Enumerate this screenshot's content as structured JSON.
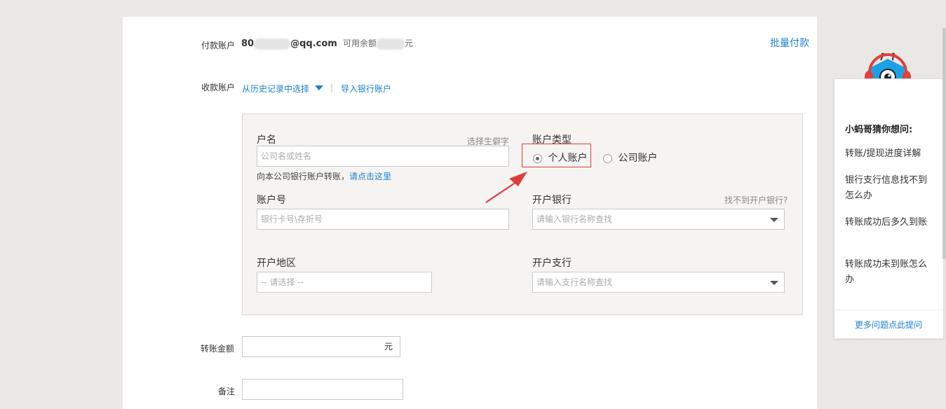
{
  "payer": {
    "label": "付款账户",
    "account_prefix": "80",
    "account_suffix": "@qq.com",
    "balance_label": "可用余额",
    "balance_unit": "元",
    "batch_link": "批量付款"
  },
  "payee": {
    "label": "收款账户",
    "history_link": "从历史记录中选择",
    "separator": "|",
    "import_link": "导入银行账户"
  },
  "form": {
    "name_label": "户名",
    "rare_char_link": "选择生僻字",
    "name_placeholder": "公司名或姓名",
    "company_hint": "向本公司银行账户转账，",
    "company_hint_link": "请点击这里",
    "account_type_label": "账户类型",
    "account_types": [
      {
        "label": "个人账户",
        "selected": true
      },
      {
        "label": "公司账户",
        "selected": false
      }
    ],
    "account_no_label": "账户号",
    "account_no_placeholder": "银行卡号\\存折号",
    "bank_label": "开户银行",
    "bank_missing_link": "找不到开户银行?",
    "bank_placeholder": "请输入银行名称查找",
    "region_label": "开户地区",
    "region_placeholder": "-- 请选择 --",
    "branch_label": "开户支行",
    "branch_placeholder": "请输入支行名称查找"
  },
  "amount": {
    "label": "转账金额",
    "unit": "元"
  },
  "note": {
    "label": "备注"
  },
  "side": {
    "title": "小蚂哥猜你想问:",
    "items": [
      "转账/提现进度详解",
      "银行支行信息找不到怎么办",
      "转账成功后多久到账",
      "转账成功未到账怎么办"
    ],
    "more_link": "更多问题点此提问"
  },
  "colors": {
    "link": "#1a7fd0",
    "highlight": "#e03a3a",
    "arrow": "#e03a3a"
  }
}
